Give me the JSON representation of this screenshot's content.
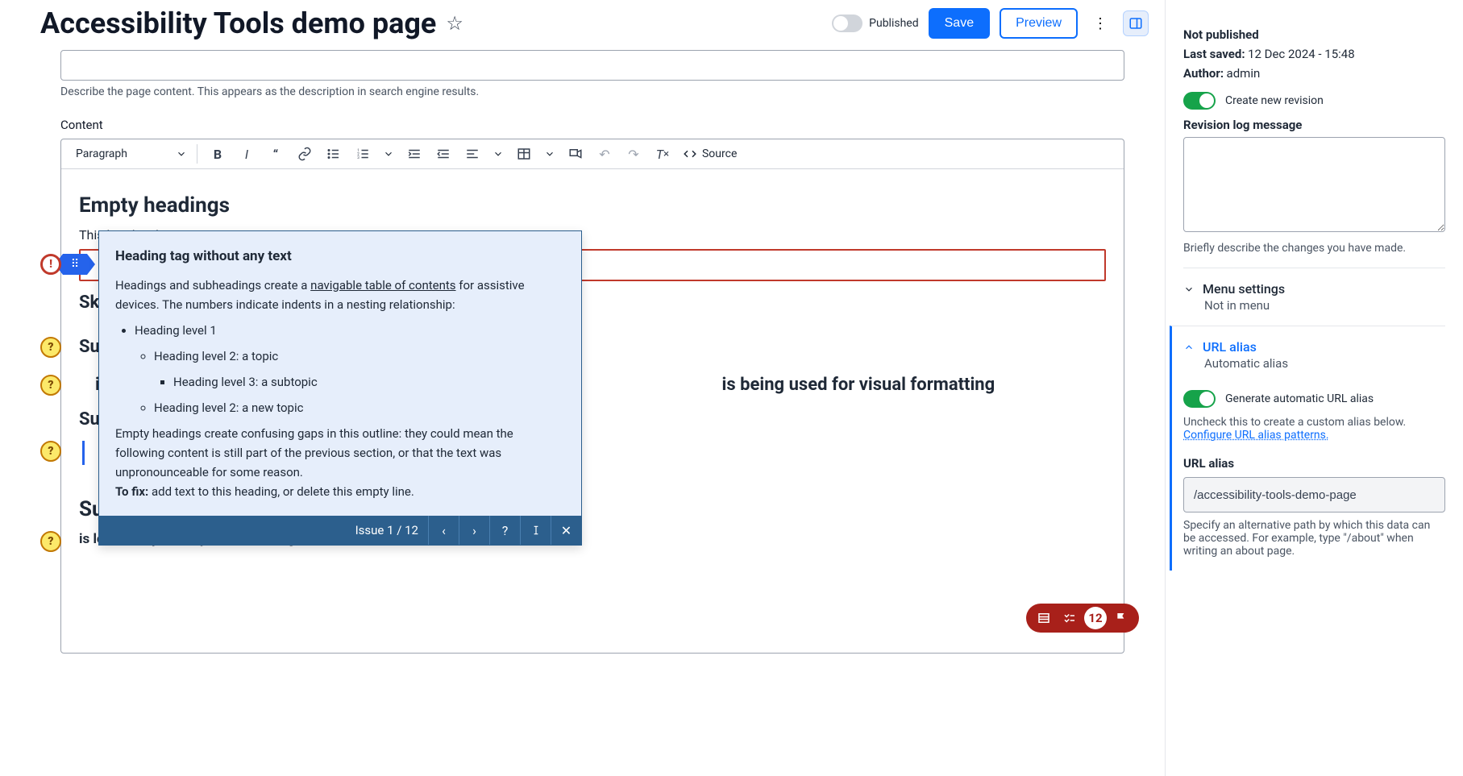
{
  "header": {
    "title": "Accessibility Tools demo page",
    "published_label": "Published",
    "save_label": "Save",
    "preview_label": "Preview"
  },
  "description_help": "Describe the page content. This appears as the description in search engine results.",
  "content_label": "Content",
  "toolbar": {
    "paragraph": "Paragraph",
    "source": "Source"
  },
  "editor": {
    "h1": "Empty headings",
    "p1": "This heading has no text:",
    "h2": "Sk",
    "h3": "Su",
    "big": "is, but rather for a document out                                                                                    is being used for visual formatting",
    "h4": "Su                                                                              headings",
    "h5": "Suspicious paragraphs that look like headings",
    "p5": "is looks suspiciously like a heading"
  },
  "callout": {
    "title": "Heading tag without any text",
    "para1a": "Headings and subheadings create a ",
    "para1link": "navigable table of contents",
    "para1b": " for assistive devices. The numbers indicate indents in a nesting relationship:",
    "li1": "Heading level 1",
    "li2": "Heading level 2: a topic",
    "li3": "Heading level 3: a subtopic",
    "li4": "Heading level 2: a new topic",
    "para2": "Empty headings create confusing gaps in this outline: they could mean the following content is still part of the previous section, or that the text was unpronounceable for some reason.",
    "fix_label": "To fix:",
    "fix_text": " add text to this heading, or delete this empty line.",
    "counter": "Issue 1 / 12"
  },
  "issue_bar": {
    "count": "12"
  },
  "sidebar": {
    "status": "Not published",
    "last_saved_label": "Last saved:",
    "last_saved": "12 Dec 2024 - 15:48",
    "author_label": "Author:",
    "author": "admin",
    "revision_toggle": "Create new revision",
    "revision_log_label": "Revision log message",
    "revision_help": "Briefly describe the changes you have made.",
    "menu_title": "Menu settings",
    "menu_sub": "Not in menu",
    "url_title": "URL alias",
    "url_sub": "Automatic alias",
    "url_toggle": "Generate automatic URL alias",
    "url_help": "Uncheck this to create a custom alias below.",
    "url_link": "Configure URL alias patterns.",
    "url_field_label": "URL alias",
    "url_field_value": "/accessibility-tools-demo-page",
    "url_field_help": "Specify an alternative path by which this data can be accessed. For example, type \"/about\" when writing an about page."
  }
}
